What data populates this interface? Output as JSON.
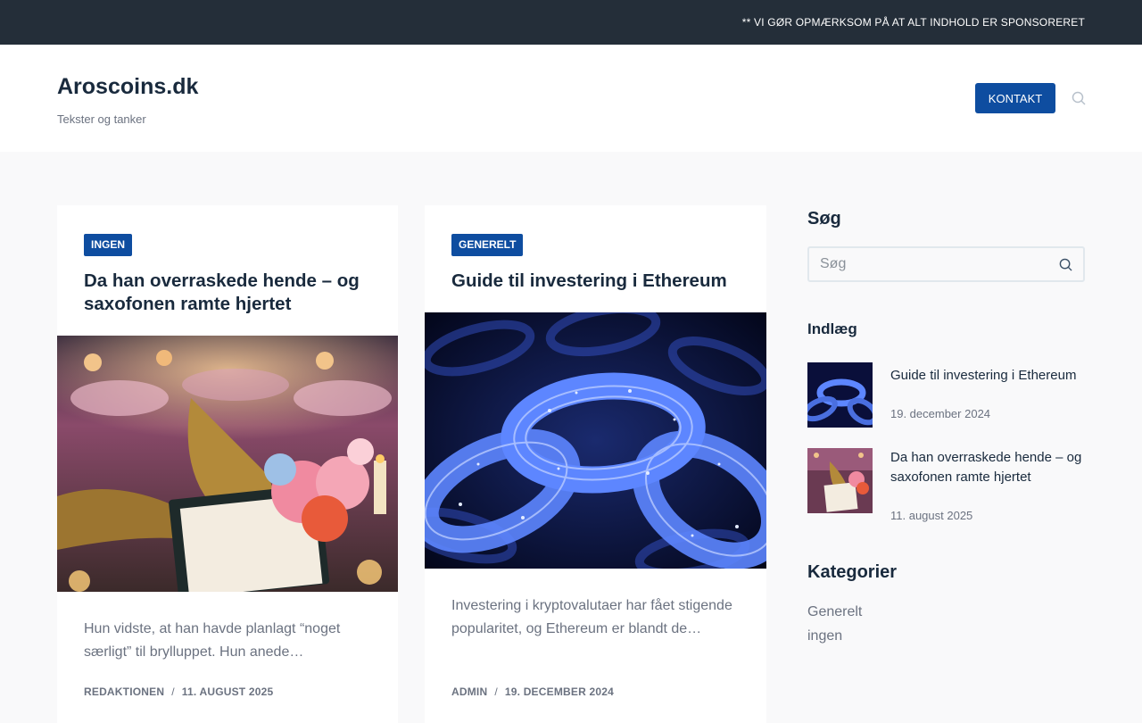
{
  "topbar": {
    "notice": "** VI GØR OPMÆRKSOM PÅ AT ALT INDHOLD ER SPONSORERET"
  },
  "header": {
    "site_title": "Aroscoins.dk",
    "tagline": "Tekster og tanker",
    "contact_label": "KONTAKT",
    "search_icon": "search-icon"
  },
  "posts": [
    {
      "category": "INGEN",
      "title": "Da han overraskede hende – og saxofonen ramte hjertet",
      "excerpt": "Hun vidste, at han havde planlagt “noget særligt” til brylluppet. Hun anede…",
      "author": "REDAKTIONEN",
      "separator": "/",
      "date": "11. AUGUST 2025"
    },
    {
      "category": "GENERELT",
      "title": "Guide til investering i Ethereum",
      "excerpt": "Investering i kryptovalutaer har fået stigende popularitet, og Ethereum er blandt de…",
      "author": "ADMIN",
      "separator": "/",
      "date": "19. DECEMBER 2024"
    }
  ],
  "sidebar": {
    "search_heading": "Søg",
    "search_placeholder": "Søg",
    "posts_heading": "Indlæg",
    "recent_posts": [
      {
        "title": "Guide til investering i Ethereum",
        "date": "19. december 2024"
      },
      {
        "title": "Da han overraskede hende – og saxofonen ramte hjertet",
        "date": "11. august 2025"
      }
    ],
    "categories_heading": "Kategorier",
    "categories": [
      "Generelt",
      "ingen"
    ]
  },
  "colors": {
    "accent": "#0e4da0",
    "topbar": "#242e39",
    "page_bg": "#f9f9fa"
  }
}
